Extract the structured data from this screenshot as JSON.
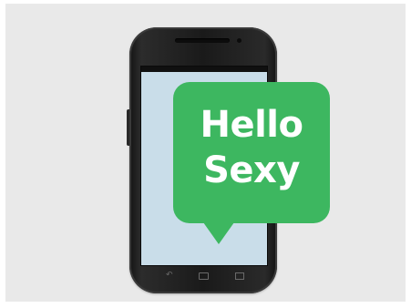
{
  "bubble": {
    "line1": "Hello",
    "line2": "Sexy",
    "color": "#3db760"
  },
  "phone": {
    "screen_color": "#c9dde9",
    "body_color": "#1a1a1a"
  },
  "nav_icons": [
    "back-icon",
    "home-icon",
    "recent-apps-icon"
  ]
}
